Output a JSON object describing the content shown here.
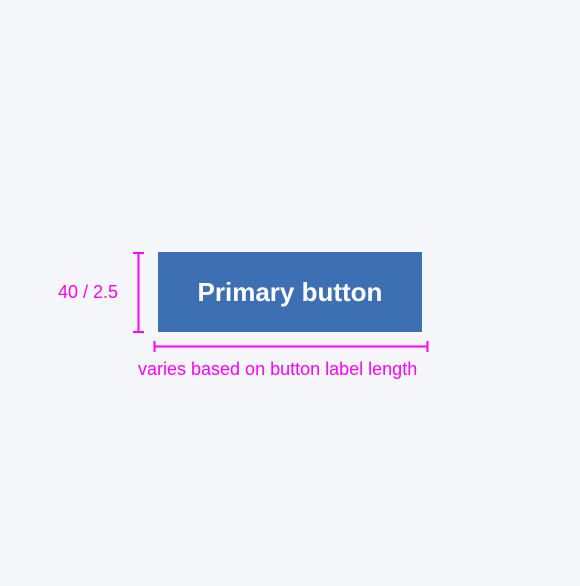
{
  "button": {
    "label": "Primary button",
    "background_color": "#3d70b2",
    "text_color": "#ffffff"
  },
  "annotations": {
    "height": "40 / 2.5",
    "width": "varies based on button label length",
    "color": "#ff00ff"
  },
  "background_color": "#f5f7fb"
}
